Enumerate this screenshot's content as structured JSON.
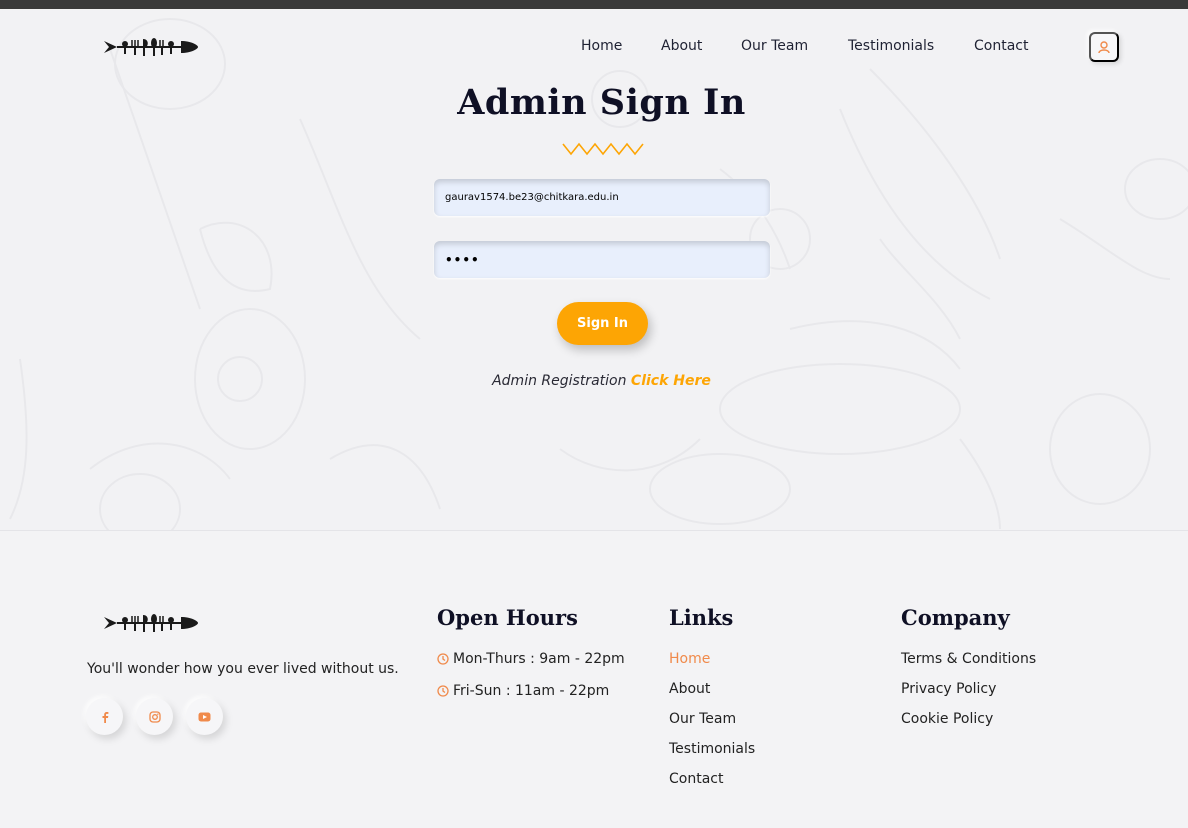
{
  "colors": {
    "accent": "#fda504",
    "link_active": "#f08a4b",
    "heading": "#0f1025",
    "background": "#f3f3f5",
    "field_bg": "#e8effc"
  },
  "header": {
    "nav": [
      {
        "label": "Home"
      },
      {
        "label": "About"
      },
      {
        "label": "Our Team"
      },
      {
        "label": "Testimonials"
      },
      {
        "label": "Contact"
      }
    ],
    "user_icon": "user-icon"
  },
  "signin": {
    "title": "Admin Sign In",
    "email_value": "gaurav1574.be23@chitkara.edu.in",
    "password_value": "••••",
    "button_label": "Sign In",
    "registration_text": "Admin Registration",
    "registration_link": "Click Here"
  },
  "footer": {
    "tagline": "You'll wonder how you ever lived without us.",
    "social": [
      "facebook-icon",
      "instagram-icon",
      "youtube-icon"
    ],
    "hours": {
      "title": "Open Hours",
      "items": [
        "Mon-Thurs : 9am - 22pm",
        "Fri-Sun : 11am - 22pm"
      ]
    },
    "links": {
      "title": "Links",
      "items": [
        "Home",
        "About",
        "Our Team",
        "Testimonials",
        "Contact"
      ]
    },
    "company": {
      "title": "Company",
      "items": [
        "Terms & Conditions",
        "Privacy Policy",
        "Cookie Policy"
      ]
    }
  }
}
